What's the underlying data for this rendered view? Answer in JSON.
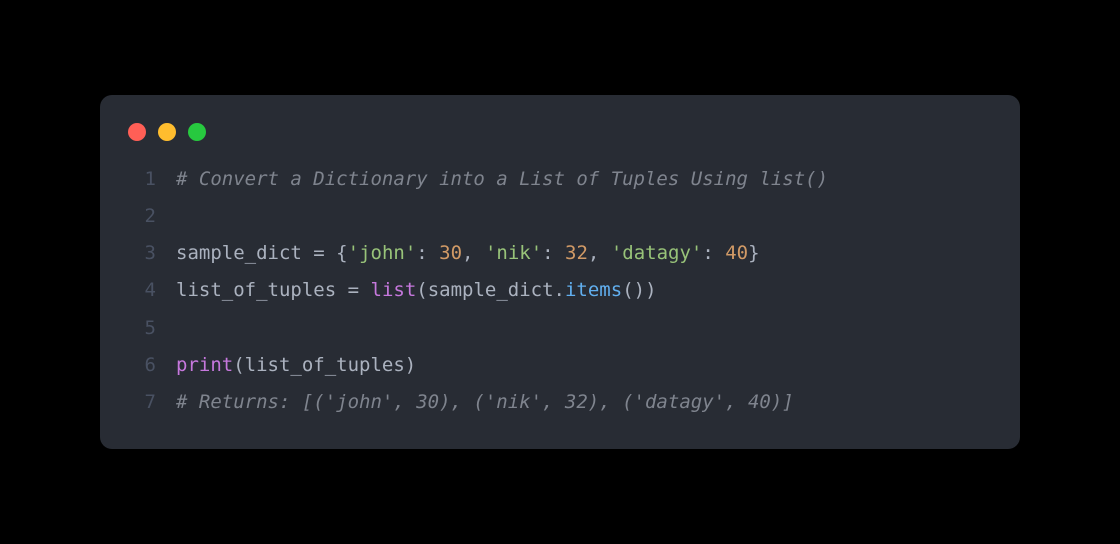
{
  "window": {
    "controls": [
      "close",
      "minimize",
      "maximize"
    ]
  },
  "code": {
    "lines": [
      {
        "num": "1",
        "tokens": [
          {
            "cls": "c-comment",
            "text": "# Convert a Dictionary into a List of Tuples Using list()"
          }
        ]
      },
      {
        "num": "2",
        "tokens": []
      },
      {
        "num": "3",
        "tokens": [
          {
            "cls": "c-ident",
            "text": "sample_dict "
          },
          {
            "cls": "c-op",
            "text": "="
          },
          {
            "cls": "c-punct",
            "text": " {"
          },
          {
            "cls": "c-string",
            "text": "'john'"
          },
          {
            "cls": "c-punct",
            "text": ": "
          },
          {
            "cls": "c-number",
            "text": "30"
          },
          {
            "cls": "c-punct",
            "text": ", "
          },
          {
            "cls": "c-string",
            "text": "'nik'"
          },
          {
            "cls": "c-punct",
            "text": ": "
          },
          {
            "cls": "c-number",
            "text": "32"
          },
          {
            "cls": "c-punct",
            "text": ", "
          },
          {
            "cls": "c-string",
            "text": "'datagy'"
          },
          {
            "cls": "c-punct",
            "text": ": "
          },
          {
            "cls": "c-number",
            "text": "40"
          },
          {
            "cls": "c-punct",
            "text": "}"
          }
        ]
      },
      {
        "num": "4",
        "tokens": [
          {
            "cls": "c-ident",
            "text": "list_of_tuples "
          },
          {
            "cls": "c-op",
            "text": "="
          },
          {
            "cls": "c-punct",
            "text": " "
          },
          {
            "cls": "c-builtin",
            "text": "list"
          },
          {
            "cls": "c-punct",
            "text": "(sample_dict."
          },
          {
            "cls": "c-method",
            "text": "items"
          },
          {
            "cls": "c-punct",
            "text": "())"
          }
        ]
      },
      {
        "num": "5",
        "tokens": []
      },
      {
        "num": "6",
        "tokens": [
          {
            "cls": "c-builtin",
            "text": "print"
          },
          {
            "cls": "c-punct",
            "text": "(list_of_tuples)"
          }
        ]
      },
      {
        "num": "7",
        "tokens": [
          {
            "cls": "c-comment",
            "text": "# Returns: [('john', 30), ('nik', 32), ('datagy', 40)]"
          }
        ]
      }
    ]
  }
}
